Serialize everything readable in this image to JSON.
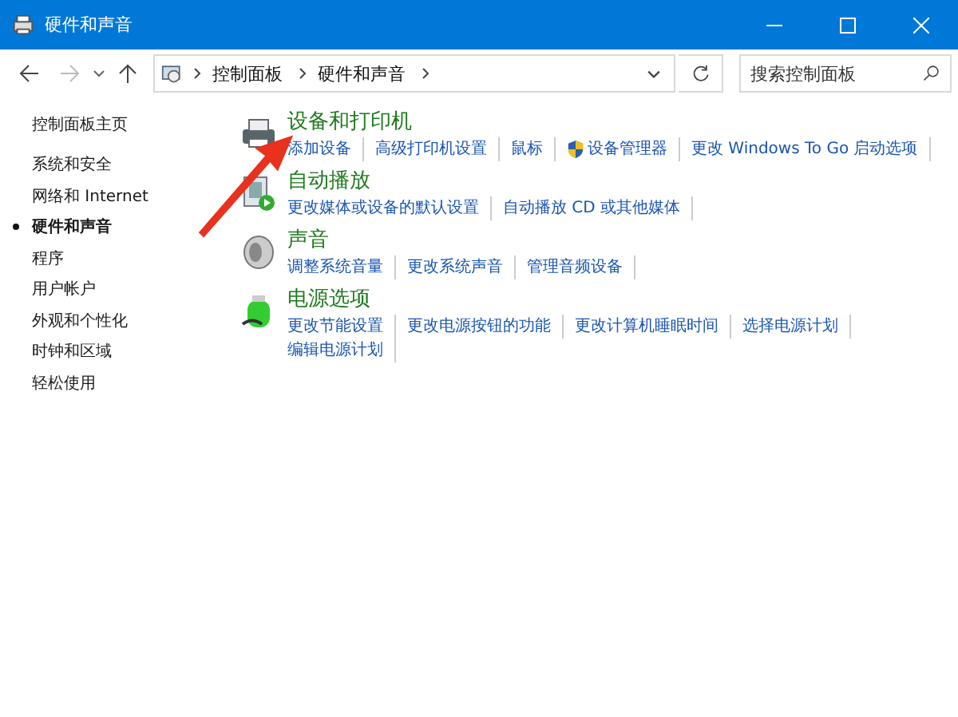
{
  "window": {
    "title": "硬件和声音"
  },
  "breadcrumb": [
    "控制面板",
    "硬件和声音"
  ],
  "search": {
    "placeholder": "搜索控制面板"
  },
  "sidebar": {
    "items": [
      {
        "label": "控制面板主页",
        "selected": false
      },
      {
        "label": "系统和安全",
        "selected": false
      },
      {
        "label": "网络和 Internet",
        "selected": false
      },
      {
        "label": "硬件和声音",
        "selected": true
      },
      {
        "label": "程序",
        "selected": false
      },
      {
        "label": "用户帐户",
        "selected": false
      },
      {
        "label": "外观和个性化",
        "selected": false
      },
      {
        "label": "时钟和区域",
        "selected": false
      },
      {
        "label": "轻松使用",
        "selected": false
      }
    ]
  },
  "categories": [
    {
      "title": "设备和打印机",
      "links": [
        {
          "text": "添加设备",
          "kind": "plain"
        },
        {
          "text": "高级打印机设置",
          "kind": "plain"
        },
        {
          "text": "鼠标",
          "kind": "plain"
        },
        {
          "text": "设备管理器",
          "kind": "admin"
        },
        {
          "text": "更改 Windows To Go 启动选项",
          "kind": "plain"
        }
      ]
    },
    {
      "title": "自动播放",
      "links": [
        {
          "text": "更改媒体或设备的默认设置",
          "kind": "plain"
        },
        {
          "text": "自动播放 CD 或其他媒体",
          "kind": "plain"
        }
      ]
    },
    {
      "title": "声音",
      "links": [
        {
          "text": "调整系统音量",
          "kind": "plain"
        },
        {
          "text": "更改系统声音",
          "kind": "plain"
        },
        {
          "text": "管理音频设备",
          "kind": "plain"
        }
      ]
    },
    {
      "title": "电源选项",
      "links": [
        {
          "text": "更改节能设置",
          "kind": "plain"
        },
        {
          "text": "更改电源按钮的功能",
          "kind": "plain"
        },
        {
          "text": "更改计算机睡眠时间",
          "kind": "plain"
        },
        {
          "text": "选择电源计划",
          "kind": "plain"
        },
        {
          "text": "编辑电源计划",
          "kind": "plain"
        }
      ]
    }
  ]
}
